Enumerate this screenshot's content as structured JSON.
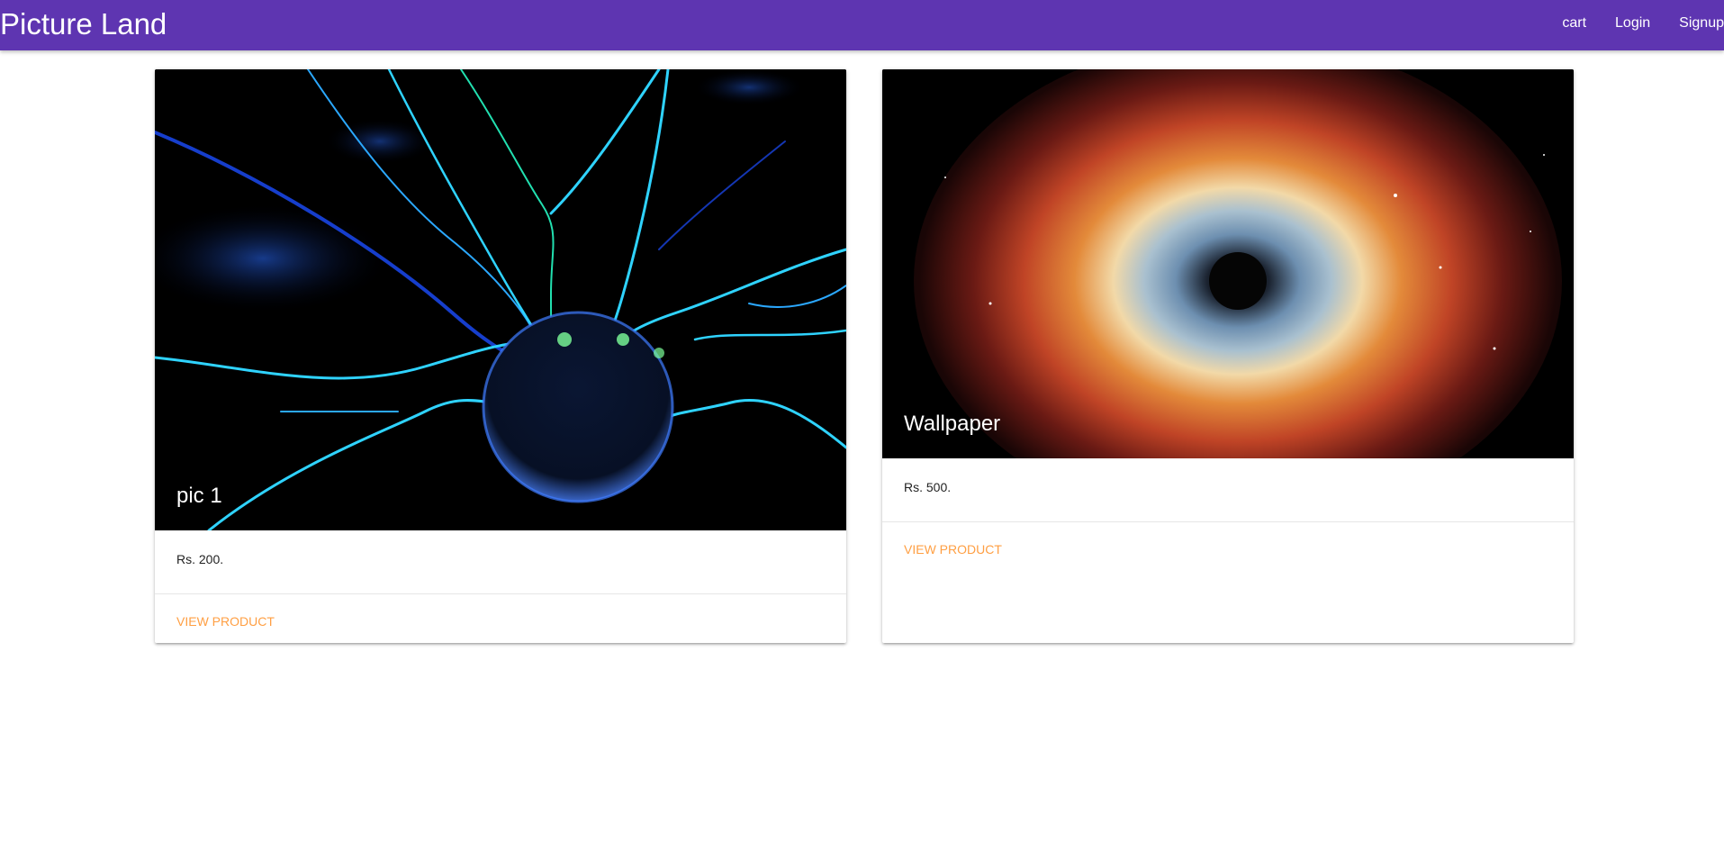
{
  "navbar": {
    "brand": "Picture Land",
    "links": [
      {
        "label": "cart"
      },
      {
        "label": "Login"
      },
      {
        "label": "Signup"
      }
    ],
    "color": "#5e35b1"
  },
  "products": [
    {
      "title": "pic 1",
      "price": "Rs. 200.",
      "action": "VIEW PRODUCT",
      "image": "plasma-ball-photo"
    },
    {
      "title": "Wallpaper",
      "price": "Rs. 500.",
      "action": "VIEW PRODUCT",
      "image": "nebula-eye-photo"
    }
  ],
  "accent_color": "#ff9f43"
}
